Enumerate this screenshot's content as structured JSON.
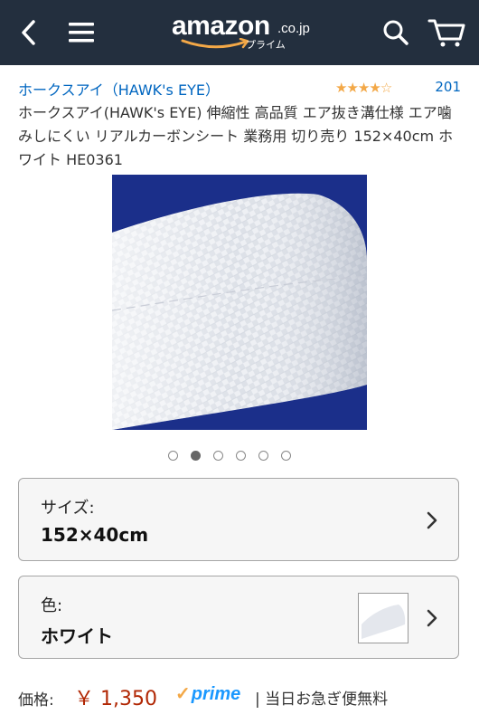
{
  "header": {
    "logo_word": "amazon",
    "logo_domain": ".co.jp",
    "logo_prime": "プライム",
    "icons": [
      "back-arrow-icon",
      "hamburger-menu-icon",
      "search-icon",
      "cart-icon"
    ],
    "background": "#232f3e"
  },
  "product": {
    "brand": "ホークスアイ（HAWK's EYE）",
    "rating_stars": 4,
    "rating_max": 5,
    "review_count": "201",
    "title": "ホークスアイ(HAWK's EYE) 伸縮性 高品質 エア抜き溝仕様 エア噛みしにくい リアルカーボンシート 業務用 切り売り 152×40cm ホワイト HE0361"
  },
  "carousel": {
    "count": 6,
    "active_index": 1
  },
  "options": {
    "size": {
      "label": "サイズ:",
      "value": "152×40cm"
    },
    "color": {
      "label": "色:",
      "value": "ホワイト"
    }
  },
  "price": {
    "label": "価格:",
    "value": "￥ 1,350",
    "prime": "prime",
    "delivery": "| 当日お急ぎ便無料"
  },
  "colors": {
    "link": "#0066c0",
    "price": "#b12704",
    "prime": "#1a98ff",
    "star": "#f3a847"
  }
}
